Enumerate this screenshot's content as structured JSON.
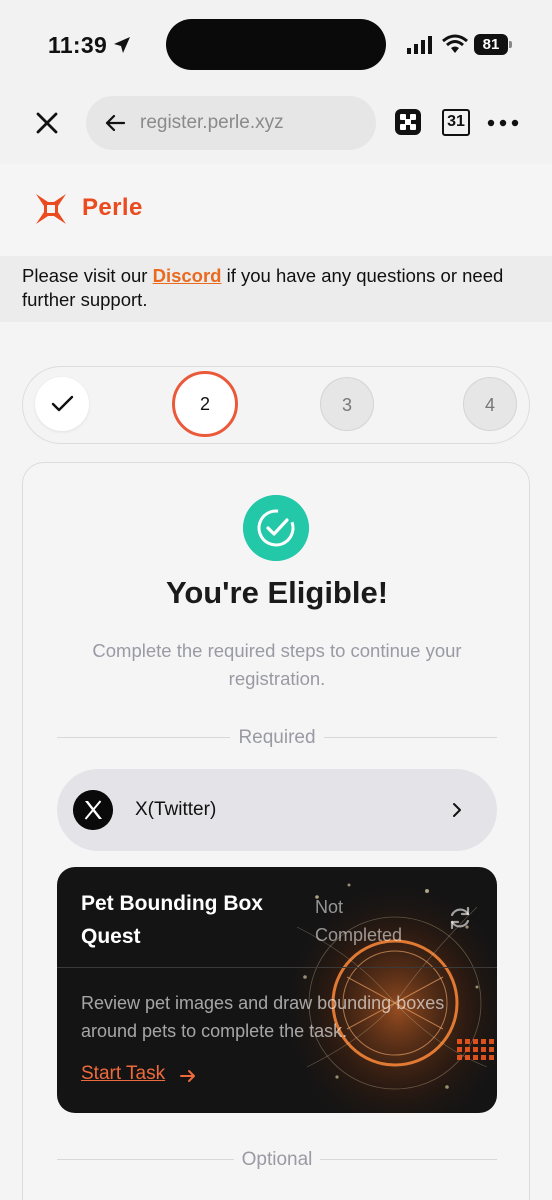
{
  "status_bar": {
    "time": "11:39",
    "battery": "81"
  },
  "browser": {
    "url": "register.perle.xyz",
    "calendar_day": "31"
  },
  "site": {
    "brand": "Perle",
    "notice": {
      "prefix": "Please visit our ",
      "link": "Discord",
      "suffix": " if you have any questions or need further support."
    }
  },
  "stepper": {
    "steps": [
      {
        "label": "✓",
        "state": "done"
      },
      {
        "label": "2",
        "state": "active"
      },
      {
        "label": "3",
        "state": "pending"
      },
      {
        "label": "4",
        "state": "pending"
      }
    ]
  },
  "eligibility": {
    "title": "You're Eligible!",
    "subtitle": "Complete the required steps to continue your registration.",
    "required_label": "Required",
    "optional_label": "Optional"
  },
  "tasks": {
    "twitter": {
      "label": "X(Twitter)"
    },
    "quest": {
      "title": "Pet Bounding Box Quest",
      "status": "Not Completed",
      "description": "Review pet images and draw bounding boxes around pets to complete the task.",
      "cta": "Start Task"
    }
  },
  "colors": {
    "accent": "#EA5A3A",
    "brand": "#EA4B1F",
    "success": "#23C8A8",
    "link": "#EA6A1F"
  },
  "icons": [
    "location-arrow-icon",
    "signal-icon",
    "wifi-icon",
    "battery-icon",
    "close-icon",
    "back-arrow-icon",
    "extension-icon",
    "calendar-icon",
    "more-icon",
    "perle-logo-icon",
    "checkmark-icon",
    "check-circle-icon",
    "x-logo-icon",
    "chevron-right-icon",
    "refresh-icon",
    "arrow-right-icon"
  ]
}
